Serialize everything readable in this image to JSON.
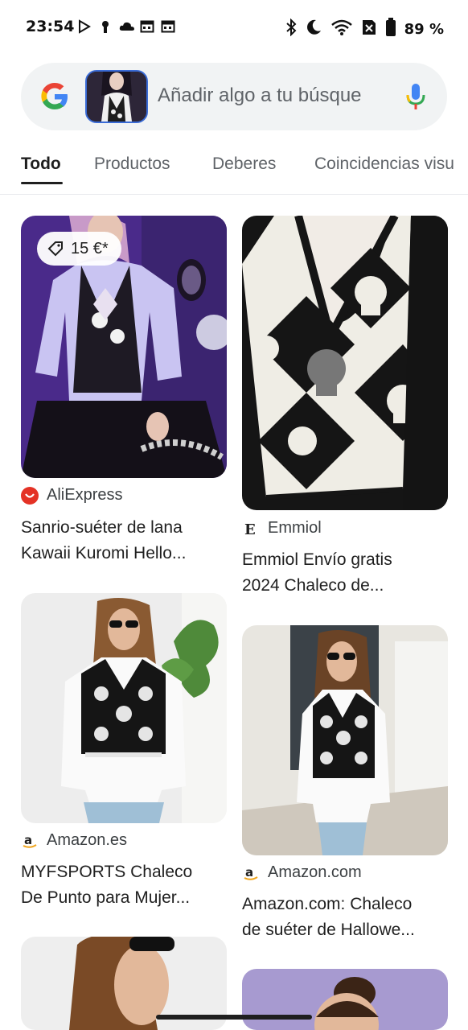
{
  "status_bar": {
    "time": "23:54",
    "battery": "89 %",
    "left_icons": [
      "play-store-icon",
      "keyhole-icon",
      "cloud-icon",
      "calendar-icon",
      "calendar-icon"
    ],
    "right_icons": [
      "bluetooth-icon",
      "moon-icon",
      "wifi-icon",
      "no-sim-icon",
      "battery-icon"
    ]
  },
  "search": {
    "placeholder": "Añadir algo a tu búsque"
  },
  "tabs": [
    {
      "label": "Todo",
      "active": true
    },
    {
      "label": "Productos",
      "active": false
    },
    {
      "label": "Deberes",
      "active": false
    },
    {
      "label": "Coincidencias visu",
      "active": false
    }
  ],
  "results": [
    {
      "price": "15 €*",
      "source": "AliExpress",
      "title_line1": "Sanrio-suéter de lana",
      "title_line2": "Kawaii Kuromi Hello..."
    },
    {
      "source": "Emmiol",
      "title_line1": "Emmiol Envío gratis",
      "title_line2": "2024 Chaleco de..."
    },
    {
      "source": "Amazon.es",
      "title_line1": "MYFSPORTS Chaleco",
      "title_line2": "De Punto para Mujer..."
    },
    {
      "source": "Amazon.com",
      "title_line1": "Amazon.com: Chaleco",
      "title_line2": "de suéter de Hallowe..."
    }
  ],
  "colors": {
    "accent": "#1f1f1f",
    "aliexpress": "#e43225",
    "google_blue": "#4285f4",
    "google_red": "#ea4335",
    "google_yellow": "#fbbc05",
    "google_green": "#34a853"
  }
}
